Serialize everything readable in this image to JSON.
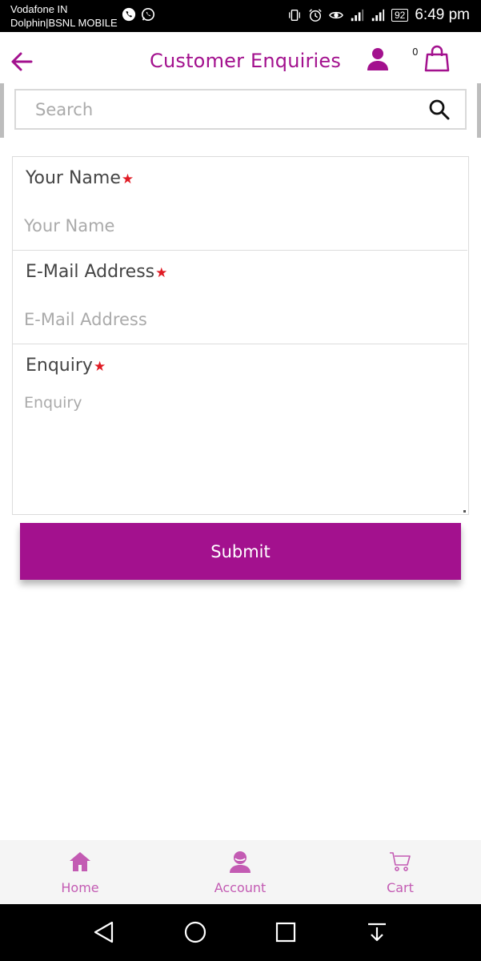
{
  "status_bar": {
    "carrier_line1": "Vodafone IN",
    "carrier_line2": "Dolphin|BSNL MOBILE",
    "battery": "92",
    "time": "6:49 pm"
  },
  "header": {
    "title": "Customer Enquiries",
    "cart_count": "0",
    "accent_color": "#a3118e"
  },
  "search": {
    "placeholder": "Search",
    "value": ""
  },
  "form": {
    "fields": [
      {
        "label": "Your Name",
        "required_mark": "★",
        "placeholder": "Your Name",
        "value": ""
      },
      {
        "label": "E-Mail Address",
        "required_mark": "★",
        "placeholder": "E-Mail Address",
        "value": ""
      },
      {
        "label": "Enquiry",
        "required_mark": "★",
        "placeholder": "Enquiry",
        "value": ""
      }
    ],
    "submit_label": "Submit"
  },
  "bottom_nav": {
    "items": [
      {
        "label": "Home",
        "icon": "home-icon"
      },
      {
        "label": "Account",
        "icon": "account-icon"
      },
      {
        "label": "Cart",
        "icon": "cart-icon"
      }
    ],
    "color": "#c35bb3"
  },
  "android_nav": {
    "buttons": [
      "back-triangle-icon",
      "home-circle-icon",
      "recents-square-icon",
      "notification-pulldown-icon"
    ]
  }
}
